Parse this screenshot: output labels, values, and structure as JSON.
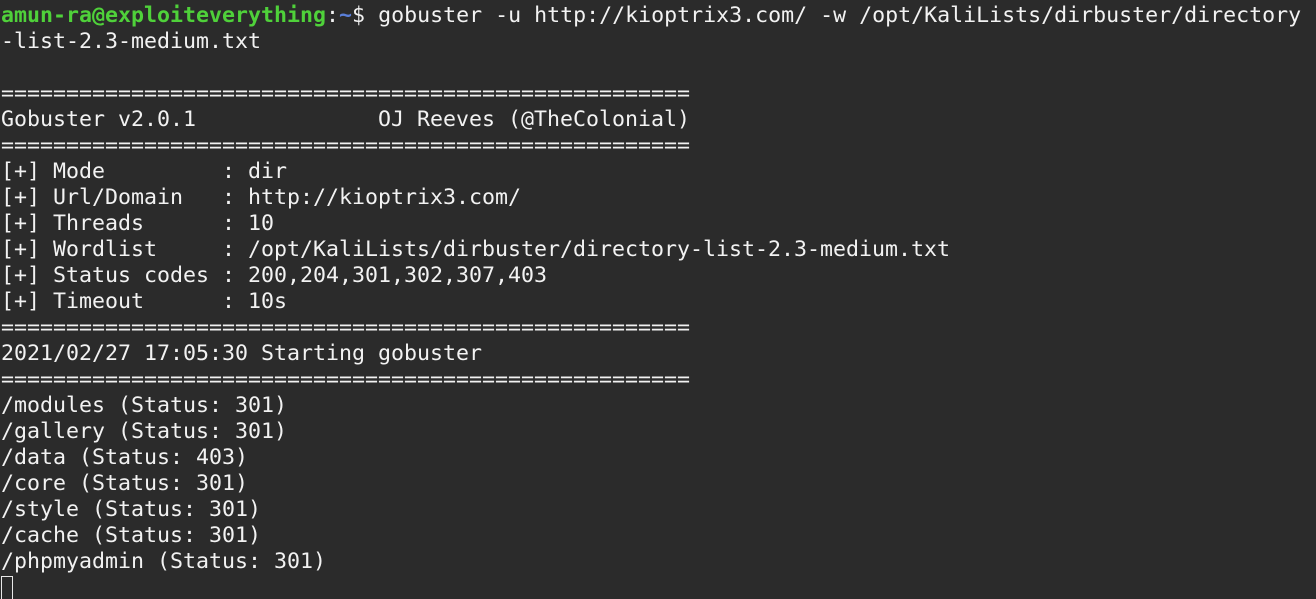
{
  "prompt": {
    "user_host": "amun-ra@exploiteverything",
    "separator": ":",
    "path": "~",
    "symbol": "$ ",
    "command": "gobuster -u http://kioptrix3.com/ -w /opt/KaliLists/dirbuster/directory",
    "command_wrap": "-list-2.3-medium.txt"
  },
  "banner": {
    "rule": "=====================================================",
    "title": "Gobuster v2.0.1              OJ Reeves (@TheColonial)"
  },
  "config": [
    "[+] Mode         : dir",
    "[+] Url/Domain   : http://kioptrix3.com/",
    "[+] Threads      : 10",
    "[+] Wordlist     : /opt/KaliLists/dirbuster/directory-list-2.3-medium.txt",
    "[+] Status codes : 200,204,301,302,307,403",
    "[+] Timeout      : 10s"
  ],
  "start_message": "2021/02/27 17:05:30 Starting gobuster",
  "results": [
    "/modules (Status: 301)",
    "/gallery (Status: 301)",
    "/data (Status: 403)",
    "/core (Status: 301)",
    "/style (Status: 301)",
    "/cache (Status: 301)",
    "/phpmyadmin (Status: 301)"
  ],
  "colors": {
    "background": "#2b2b2b",
    "foreground": "#f2f2f2",
    "user_host": "#4fd13a",
    "path": "#5a7fd8"
  }
}
